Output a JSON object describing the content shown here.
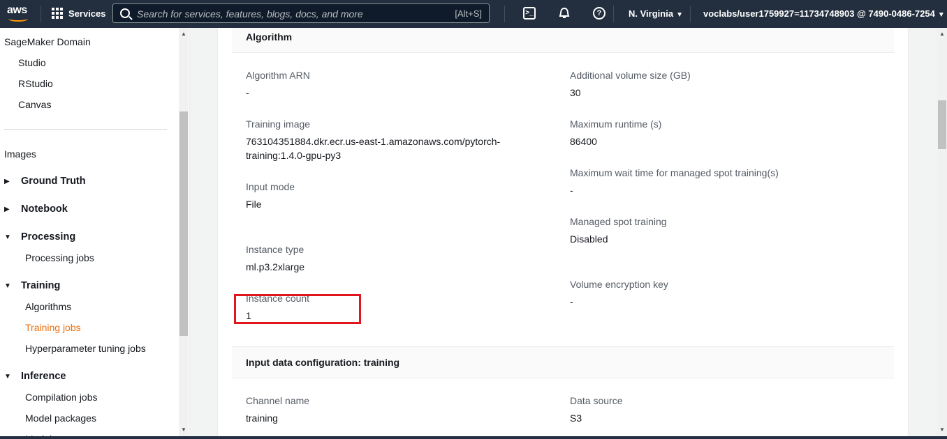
{
  "topnav": {
    "logo_text": "aws",
    "services_label": "Services",
    "search_placeholder": "Search for services, features, blogs, docs, and more",
    "search_shortcut": "[Alt+S]",
    "region": "N. Virginia",
    "account": "voclabs/user1759927=11734748903 @ 7490-0486-7254"
  },
  "sidebar": {
    "domain": "SageMaker Domain",
    "domain_items": [
      "Studio",
      "RStudio",
      "Canvas"
    ],
    "images": "Images",
    "sections": [
      {
        "label": "Ground Truth",
        "expanded": false,
        "items": []
      },
      {
        "label": "Notebook",
        "expanded": false,
        "items": []
      },
      {
        "label": "Processing",
        "expanded": true,
        "items": [
          "Processing jobs"
        ]
      },
      {
        "label": "Training",
        "expanded": true,
        "items": [
          "Algorithms",
          "Training jobs",
          "Hyperparameter tuning jobs"
        ]
      },
      {
        "label": "Inference",
        "expanded": true,
        "items": [
          "Compilation jobs",
          "Model packages",
          "Models"
        ]
      }
    ],
    "active_item": "Training jobs",
    "accent_color": "#ec7211"
  },
  "algorithm": {
    "title": "Algorithm",
    "left": [
      {
        "label": "Algorithm ARN",
        "value": "-"
      },
      {
        "label": "Training image",
        "value_line1": "763104351884.dkr.ecr.us-east-1.amazonaws.com/pytorch-",
        "value_line2": "training:1.4.0-gpu-py3"
      },
      {
        "label": "Input mode",
        "value": "File"
      },
      {
        "label": "Instance type",
        "value": "ml.p3.2xlarge"
      },
      {
        "label": "Instance count",
        "value": "1"
      }
    ],
    "right": [
      {
        "label": "Additional volume size (GB)",
        "value": "30"
      },
      {
        "label": "Maximum runtime (s)",
        "value": "86400"
      },
      {
        "label": "Maximum wait time for managed spot training(s)",
        "value": "-"
      },
      {
        "label": "Managed spot training",
        "value": "Disabled"
      },
      {
        "label": "Volume encryption key",
        "value": "-"
      }
    ]
  },
  "input_data": {
    "title": "Input data configuration: training",
    "left": [
      {
        "label": "Channel name",
        "value": "training"
      }
    ],
    "right": [
      {
        "label": "Data source",
        "value": "S3"
      }
    ]
  },
  "colors": {
    "highlight_box": "#e0151e",
    "nav_bg": "#232f3e"
  }
}
